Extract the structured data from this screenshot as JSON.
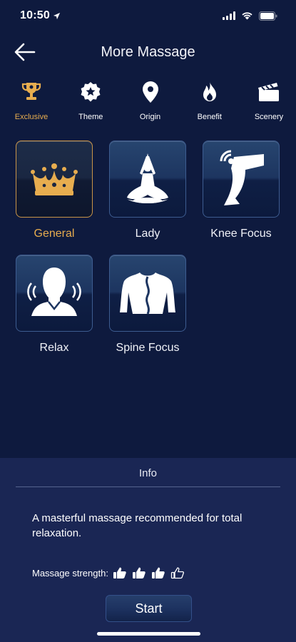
{
  "status": {
    "time": "10:50"
  },
  "header": {
    "title": "More Massage"
  },
  "categories": [
    {
      "label": "Exclusive",
      "icon": "trophy-icon",
      "active": true
    },
    {
      "label": "Theme",
      "icon": "star-badge-icon",
      "active": false
    },
    {
      "label": "Origin",
      "icon": "location-pin-icon",
      "active": false
    },
    {
      "label": "Benefit",
      "icon": "flame-icon",
      "active": false
    },
    {
      "label": "Scenery",
      "icon": "clapperboard-icon",
      "active": false
    }
  ],
  "programs": [
    {
      "label": "General",
      "icon": "crown-icon",
      "selected": true
    },
    {
      "label": "Lady",
      "icon": "meditation-icon",
      "selected": false
    },
    {
      "label": "Knee Focus",
      "icon": "knee-icon",
      "selected": false
    },
    {
      "label": "Relax",
      "icon": "relax-head-icon",
      "selected": false
    },
    {
      "label": "Spine Focus",
      "icon": "spine-back-icon",
      "selected": false
    }
  ],
  "info": {
    "title": "Info",
    "description": "A masterful massage recommended for total relaxation.",
    "strength_label": "Massage strength:",
    "strength_level": 3,
    "strength_max": 4,
    "start_label": "Start"
  },
  "colors": {
    "background": "#0e1a3e",
    "accent": "#e7ad4f",
    "panel": "#1a2654"
  }
}
